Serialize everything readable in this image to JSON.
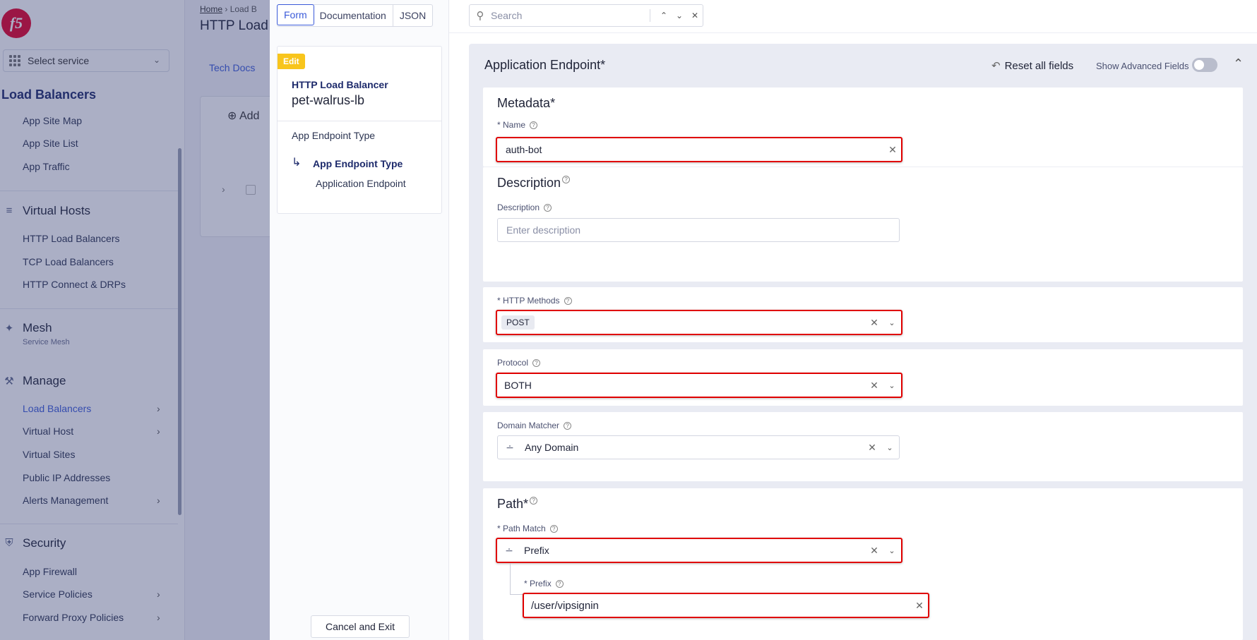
{
  "sidebar": {
    "service_select": "Select service",
    "title": "Load Balancers",
    "top_items": [
      "App Site Map",
      "App Site List",
      "App Traffic"
    ],
    "virtual_hosts": {
      "label": "Virtual Hosts",
      "items": [
        "HTTP Load Balancers",
        "TCP Load Balancers",
        "HTTP Connect & DRPs"
      ]
    },
    "mesh": {
      "label": "Mesh",
      "caption": "Service Mesh"
    },
    "manage": {
      "label": "Manage",
      "items": [
        "Load Balancers",
        "Virtual Host",
        "Virtual Sites",
        "Public IP Addresses",
        "Alerts Management"
      ]
    },
    "security": {
      "label": "Security",
      "items": [
        "App Firewall",
        "Service Policies",
        "Forward Proxy Policies"
      ]
    }
  },
  "background": {
    "breadcrumb_home": "Home",
    "breadcrumb_current": "Load B",
    "page_title": "HTTP Load",
    "tech_docs": "Tech Docs",
    "add_button": "Add"
  },
  "drawer": {
    "tabs": [
      "Form",
      "Documentation",
      "JSON"
    ],
    "active_tab": "Form",
    "edit_badge": "Edit",
    "object_type": "HTTP Load Balancer",
    "object_name": "pet-walrus-lb",
    "nav_items": [
      "App Endpoint Type",
      "App Endpoint Type",
      "Application Endpoint"
    ],
    "cancel_label": "Cancel and Exit",
    "search_placeholder": "Search"
  },
  "form": {
    "section_title": "Application Endpoint",
    "required_mark": "*",
    "reset_label": "Reset all fields",
    "advanced_label": "Show Advanced Fields",
    "advanced_on": false,
    "metadata": {
      "title": "Metadata",
      "name_label": "Name",
      "name_value": "auth-bot"
    },
    "description": {
      "title": "Description",
      "label": "Description",
      "placeholder": "Enter description"
    },
    "http_methods": {
      "label": "HTTP Methods",
      "values": [
        "POST"
      ]
    },
    "protocol": {
      "label": "Protocol",
      "value": "BOTH"
    },
    "domain_matcher": {
      "label": "Domain Matcher",
      "value": "Any Domain"
    },
    "path": {
      "title": "Path",
      "match_label": "Path Match",
      "match_value": "Prefix",
      "prefix_label": "Prefix",
      "prefix_value": "/user/vipsignin"
    }
  }
}
